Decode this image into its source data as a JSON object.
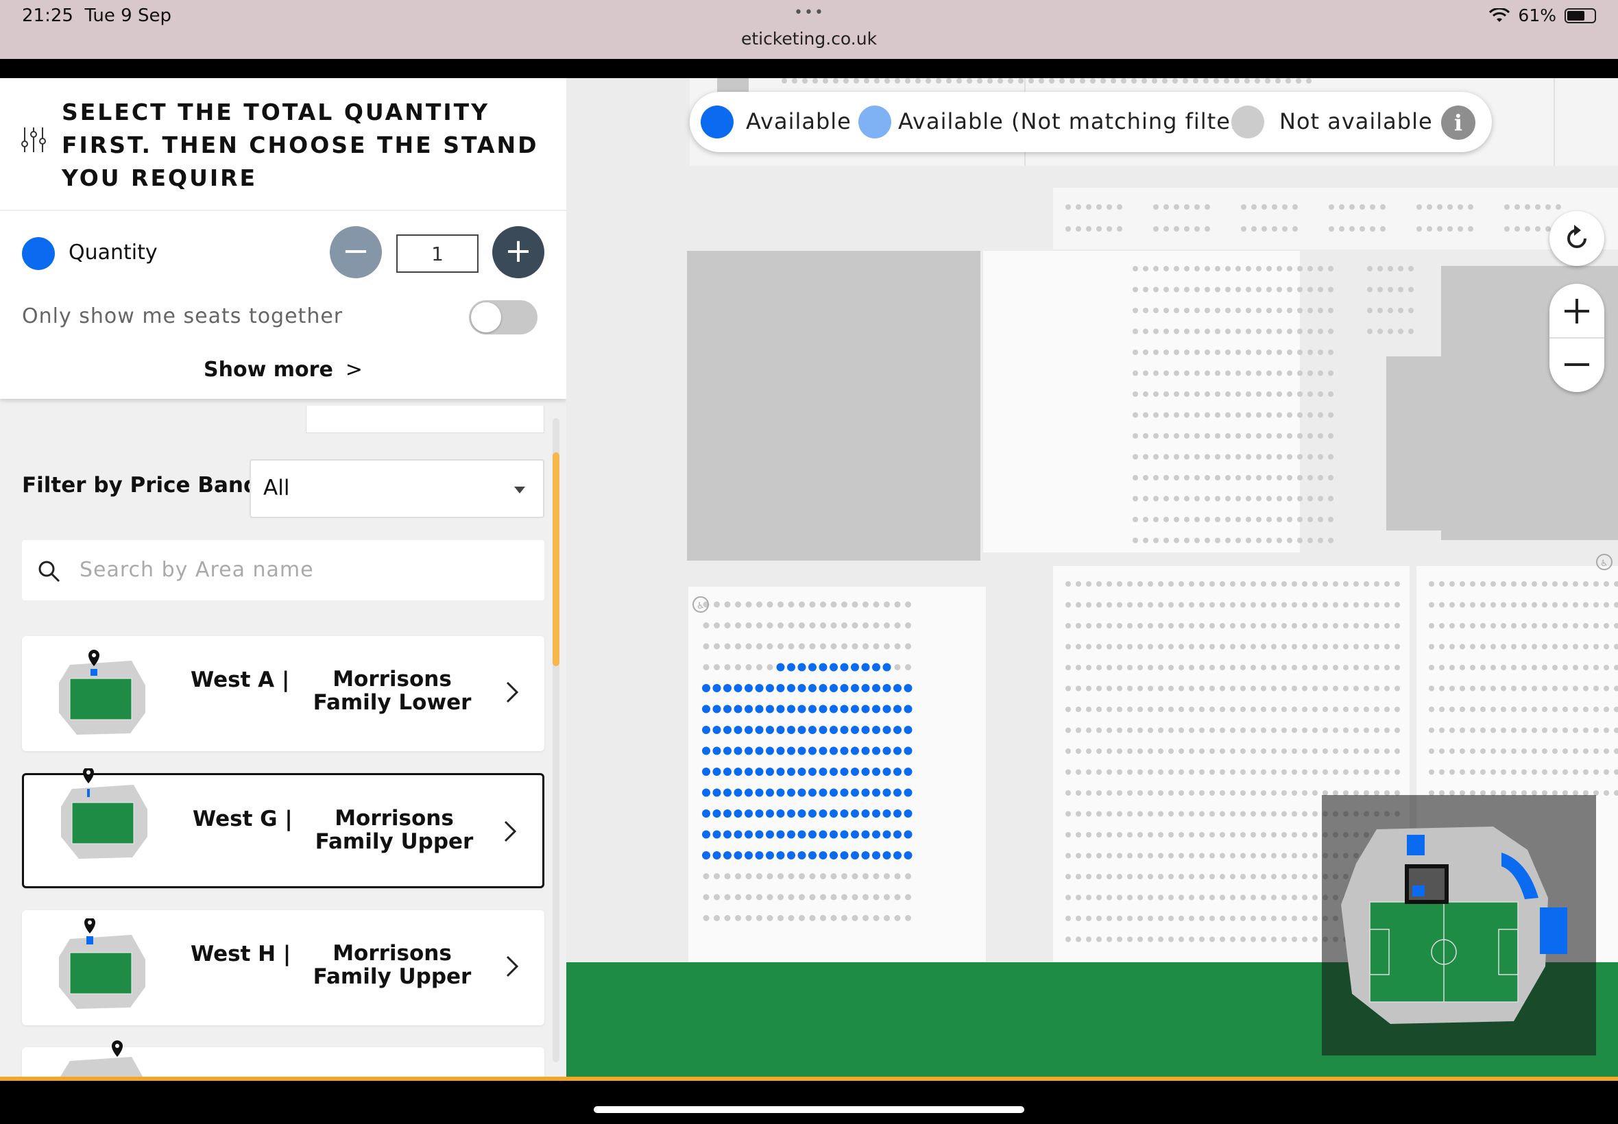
{
  "status_bar": {
    "time": "21:25",
    "date": "Tue 9 Sep",
    "url": "eticketing.co.uk",
    "battery": "61%"
  },
  "panel": {
    "instructions": "SELECT THE TOTAL QUANTITY FIRST. THEN CHOOSE THE STAND YOU REQUIRE",
    "quantity_label": "Quantity",
    "quantity_value": "1",
    "seats_together_label": "Only show me seats together",
    "seats_together_on": false,
    "show_more_label": "Show more",
    "price_band_label": "Filter by Price Band",
    "price_band_value": "All",
    "search_placeholder": "Search by Area name"
  },
  "areas": [
    {
      "stand": "West A |",
      "name": "Morrisons Family Lower",
      "selected": false
    },
    {
      "stand": "West G |",
      "name": "Morrisons Family Upper",
      "selected": true
    },
    {
      "stand": "West H |",
      "name": "Morrisons Family Upper",
      "selected": false
    }
  ],
  "legend": {
    "available": "Available",
    "not_matching": "Available (Not matching filters)",
    "not_available": "Not available"
  },
  "colors": {
    "available": "#0a6af0",
    "not_matching": "#7fb2f5",
    "not_available": "#cccccc",
    "pitch": "#1f8c45",
    "accent": "#f5a623"
  }
}
